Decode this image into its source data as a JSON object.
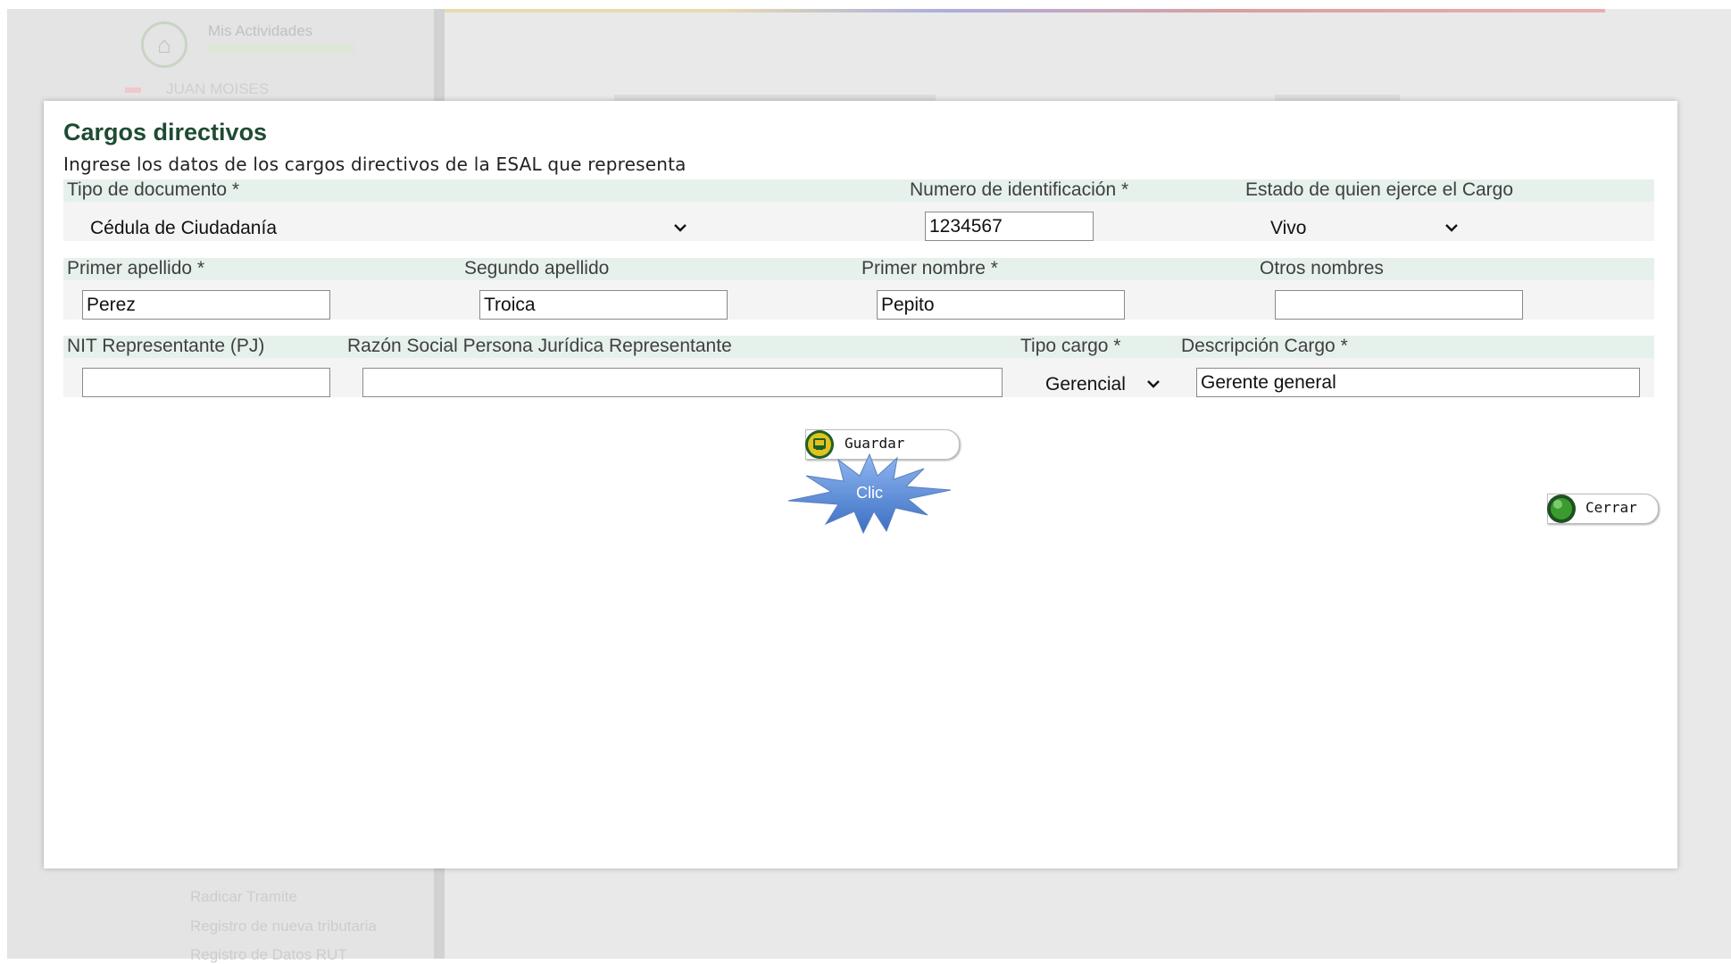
{
  "background": {
    "app_title": "Mis Actividades",
    "user_name": "JUAN MOISES",
    "sidebar_links": [
      "Radicar Tramite",
      "Registro de nueva tributaria",
      "Registro de Datos RUT"
    ]
  },
  "modal": {
    "title": "Cargos directivos",
    "subtitle": "Ingrese los datos de los cargos directivos de la ESAL que representa",
    "fields": {
      "tipo_documento": {
        "label": "Tipo de documento *",
        "value": "Cédula de Ciudadanía"
      },
      "numero_identificacion": {
        "label": "Numero de identificación *",
        "value": "1234567"
      },
      "estado_cargo": {
        "label": "Estado de quien ejerce el Cargo",
        "value": "Vivo"
      },
      "primer_apellido": {
        "label": "Primer apellido *",
        "value": "Perez"
      },
      "segundo_apellido": {
        "label": "Segundo apellido",
        "value": "Troica"
      },
      "primer_nombre": {
        "label": "Primer nombre *",
        "value": "Pepito"
      },
      "otros_nombres": {
        "label": "Otros nombres",
        "value": ""
      },
      "nit_representante": {
        "label": "NIT Representante (PJ)",
        "value": ""
      },
      "razon_social": {
        "label": "Razón Social Persona Jurídica Representante",
        "value": ""
      },
      "tipo_cargo": {
        "label": "Tipo cargo *",
        "value": "Gerencial"
      },
      "descripcion_cargo": {
        "label": "Descripción Cargo *",
        "value": "Gerente general"
      }
    },
    "buttons": {
      "guardar": "Guardar",
      "cerrar": "Cerrar"
    },
    "callout": "Clic"
  },
  "colors": {
    "title_green": "#1f4b33",
    "label_band": "#e6f1ec",
    "callout_blue": "#5a8fd8"
  }
}
